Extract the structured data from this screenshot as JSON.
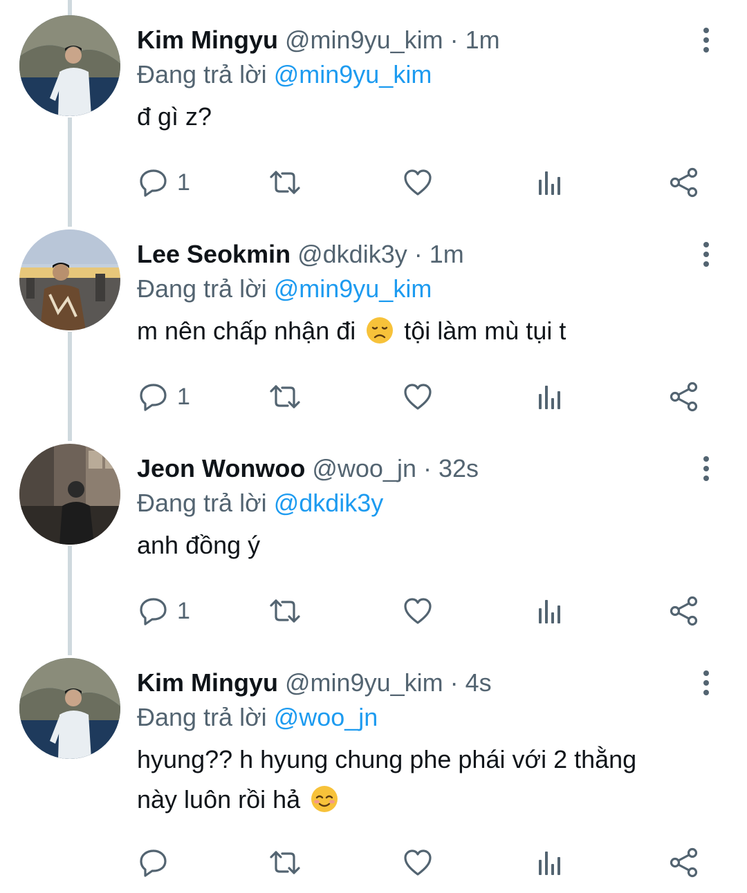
{
  "tweets": [
    {
      "name": "Kim Mingyu",
      "handle": "@min9yu_kim",
      "separator": "·",
      "time": "1m",
      "reply_prefix": "Đang trả lời",
      "reply_mention": "@min9yu_kim",
      "text_parts": [
        "đ gì z?"
      ],
      "reply_count": "1",
      "avatar": "photo-man-white-shirt-coastal-cliff"
    },
    {
      "name": "Lee Seokmin",
      "handle": "@dkdik3y",
      "separator": "·",
      "time": "1m",
      "reply_prefix": "Đang trả lời",
      "reply_mention": "@min9yu_kim",
      "text_parts": [
        "m nên chấp nhận đi",
        "tội làm mù tụi t"
      ],
      "reply_count": "1",
      "avatar": "photo-man-sunset-city"
    },
    {
      "name": "Jeon Wonwoo",
      "handle": "@woo_jn",
      "separator": "·",
      "time": "32s",
      "reply_prefix": "Đang trả lời",
      "reply_mention": "@dkdik3y",
      "text_parts": [
        "anh đồng ý"
      ],
      "reply_count": "1",
      "avatar": "photo-man-dark-street"
    },
    {
      "name": "Kim Mingyu",
      "handle": "@min9yu_kim",
      "separator": "·",
      "time": "4s",
      "reply_prefix": "Đang trả lời",
      "reply_mention": "@woo_jn",
      "text_parts": [
        "hyung?? h hyung chung phe phái với 2 thằng",
        "này luôn rồi hả"
      ],
      "reply_count": "",
      "avatar": "photo-man-white-shirt-coastal-cliff"
    }
  ],
  "icons": {
    "reply": "reply-icon",
    "retweet": "retweet-icon",
    "like": "like-icon",
    "views": "views-icon",
    "share": "share-icon",
    "more": "more-icon",
    "emoji_sad": "disappointed-face-emoji",
    "emoji_relieved": "relieved-smiling-face-emoji"
  },
  "colors": {
    "text": "#0f1419",
    "secondary": "#536471",
    "mention": "#1d9bf0",
    "thread_line": "#cfd9de"
  }
}
